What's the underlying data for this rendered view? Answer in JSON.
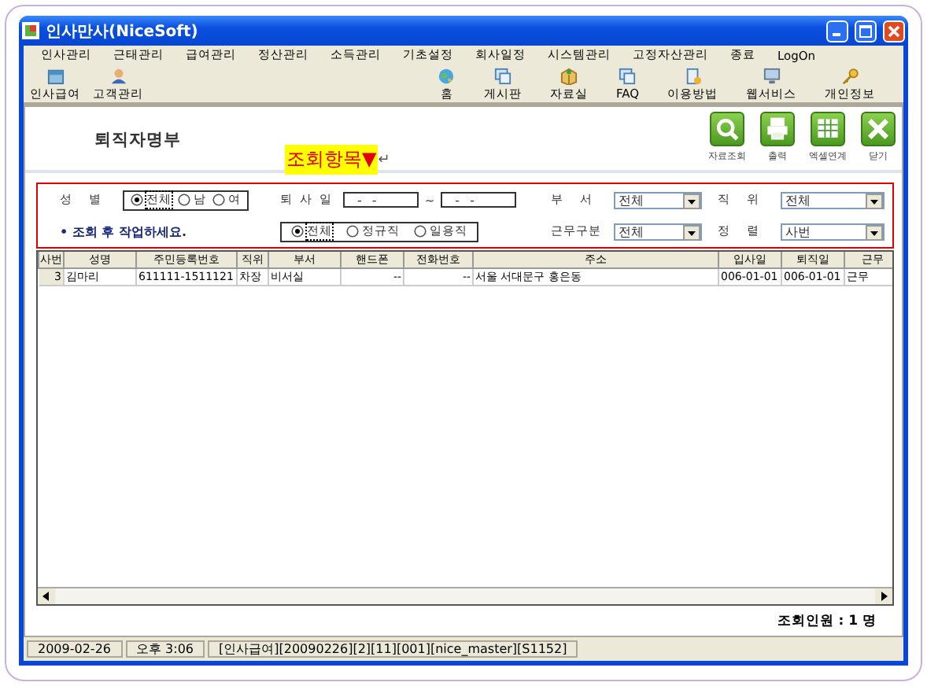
{
  "window": {
    "title": "인사만사(NiceSoft)"
  },
  "menu": [
    "인사관리",
    "근태관리",
    "급여관리",
    "정산관리",
    "소득관리",
    "기초설정",
    "회사일정",
    "시스템관리",
    "고정자산관리",
    "종료",
    "LogOn"
  ],
  "toolbar_left": [
    {
      "label": "인사급여",
      "kind": "calendar"
    },
    {
      "label": "고객관리",
      "kind": "person"
    }
  ],
  "toolbar_right": [
    {
      "label": "홈",
      "kind": "globe"
    },
    {
      "label": "게시판",
      "kind": "board"
    },
    {
      "label": "자료실",
      "kind": "box"
    },
    {
      "label": "FAQ",
      "kind": "board"
    },
    {
      "label": "이용방법",
      "kind": "doc"
    },
    {
      "label": "웹서비스",
      "kind": "monitor"
    },
    {
      "label": "개인정보",
      "kind": "key"
    }
  ],
  "page_title": "퇴직자명부",
  "section_toggle": {
    "label": "조회항목",
    "marker": "▼",
    "return_mark": "↵"
  },
  "actions": [
    {
      "label": "자료조회",
      "kind": "search"
    },
    {
      "label": "출력",
      "kind": "print"
    },
    {
      "label": "엑셀연계",
      "kind": "sheet"
    },
    {
      "label": "닫기",
      "kind": "close"
    }
  ],
  "filters": {
    "gender": {
      "label": "성 별",
      "options": [
        {
          "label": "전체",
          "selected": true
        },
        {
          "label": "남",
          "selected": false
        },
        {
          "label": "여",
          "selected": false
        }
      ]
    },
    "retire_date": {
      "label": "퇴 사 일",
      "from": "- -",
      "separator": "~",
      "to": "- -"
    },
    "dept": {
      "label": "부 서",
      "value": "전체"
    },
    "position": {
      "label": "직 위",
      "value": "전체"
    },
    "hint": "• 조회 후 작업하세요.",
    "employment": {
      "options": [
        {
          "label": "전체",
          "selected": true
        },
        {
          "label": "정규직",
          "selected": false
        },
        {
          "label": "일용직",
          "selected": false
        }
      ]
    },
    "work_type": {
      "label": "근무구분",
      "value": "전체"
    },
    "sort": {
      "label": "정 렬",
      "value": "사번"
    }
  },
  "table": {
    "columns": [
      "사번",
      "성명",
      "주민등록번호",
      "직위",
      "부서",
      "핸드폰",
      "전화번호",
      "주소",
      "입사일",
      "퇴직일",
      "근무"
    ],
    "rows": [
      [
        "3",
        "김마리",
        "611111-1511121",
        "차장",
        "비서실",
        "--",
        "--",
        "서울 서대문구 홍은동",
        "006-01-01",
        "006-01-01",
        "근무"
      ]
    ]
  },
  "count": "조회인원 : 1 명",
  "status_bar": [
    "2009-02-26",
    "오후 3:06",
    "[인사급여][20090226][2][11][001][nice_master][S1152]"
  ]
}
